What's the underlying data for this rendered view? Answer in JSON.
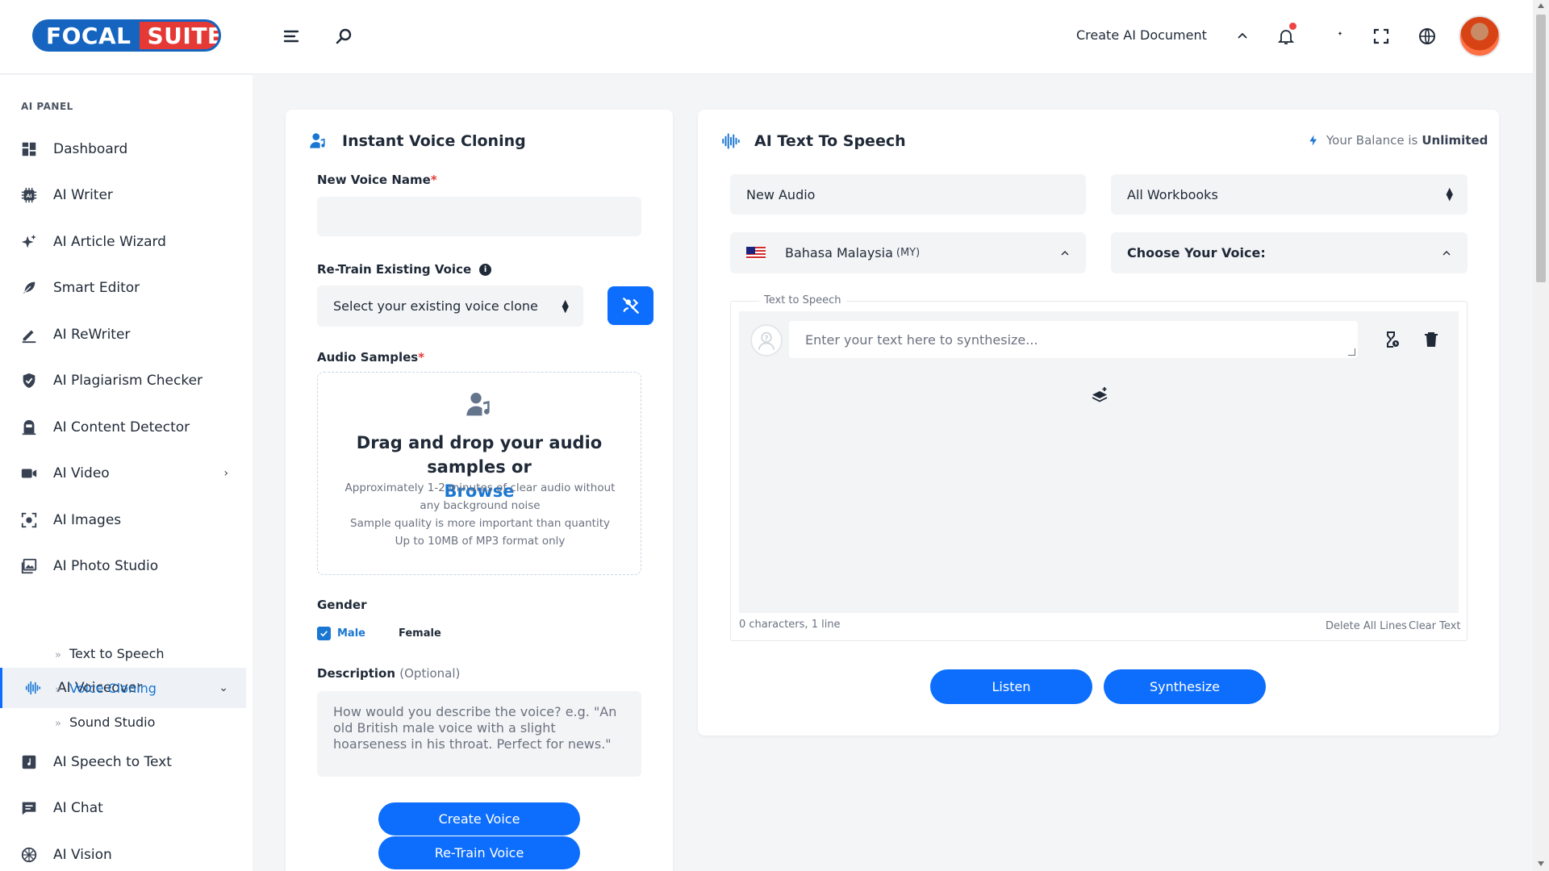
{
  "header": {
    "logo_part1": "FOCAL",
    "logo_part2": "SUITE",
    "create_doc_label": "Create AI Document"
  },
  "sidebar": {
    "title": "AI PANEL",
    "items": [
      {
        "label": "Dashboard"
      },
      {
        "label": "AI Writer"
      },
      {
        "label": "AI Article Wizard"
      },
      {
        "label": "Smart Editor"
      },
      {
        "label": "AI ReWriter"
      },
      {
        "label": "AI Plagiarism Checker"
      },
      {
        "label": "AI Content Detector"
      },
      {
        "label": "AI Video"
      },
      {
        "label": "AI Images"
      },
      {
        "label": "AI Photo Studio"
      },
      {
        "label": "AI Voiceover"
      },
      {
        "label": "AI Speech to Text"
      },
      {
        "label": "AI Chat"
      },
      {
        "label": "AI Vision"
      }
    ],
    "subitems": [
      {
        "label": "Text to Speech"
      },
      {
        "label": "Voice Cloning"
      },
      {
        "label": "Sound Studio"
      }
    ]
  },
  "voice_cloning": {
    "title": "Instant Voice Cloning",
    "name_label": "New Voice Name",
    "name_value": "",
    "retrain_label": "Re-Train Existing Voice",
    "retrain_select": "Select your existing voice clone",
    "samples_label": "Audio Samples",
    "dz_title": "Drag and drop your audio samples or",
    "dz_browse": "Browse",
    "dz_note1": "Approximately 1-2 minutes of clear audio without any background noise",
    "dz_note2": "Sample quality is more important than quantity",
    "dz_note3": "Up to 10MB of MP3 format only",
    "gender_label": "Gender",
    "gender_male": "Male",
    "gender_female": "Female",
    "desc_label": "Description",
    "desc_optional": "(Optional)",
    "desc_placeholder": "How would you describe the voice? e.g. \"An old British male voice with a slight hoarseness in his throat. Perfect for news.\"",
    "create_button": "Create Voice",
    "retrain_button": "Re-Train Voice"
  },
  "tts": {
    "title": "AI Text To Speech",
    "balance_prefix": "Your Balance is",
    "balance_value": "Unlimited",
    "audio_name": "New Audio",
    "workbook": "All Workbooks",
    "language": "Bahasa Malaysia",
    "language_code": "(MY)",
    "voice_label": "Choose Your Voice:",
    "legend": "Text to Speech",
    "text_placeholder": "Enter your text here to synthesize...",
    "char_count": "0 characters, 1 line",
    "delete_all": "Delete All Lines",
    "clear_text": "Clear Text",
    "listen_button": "Listen",
    "synthesize_button": "Synthesize"
  },
  "colors": {
    "primary": "#0d6efd",
    "accent_link": "#1976d2",
    "required": "#e53935"
  }
}
